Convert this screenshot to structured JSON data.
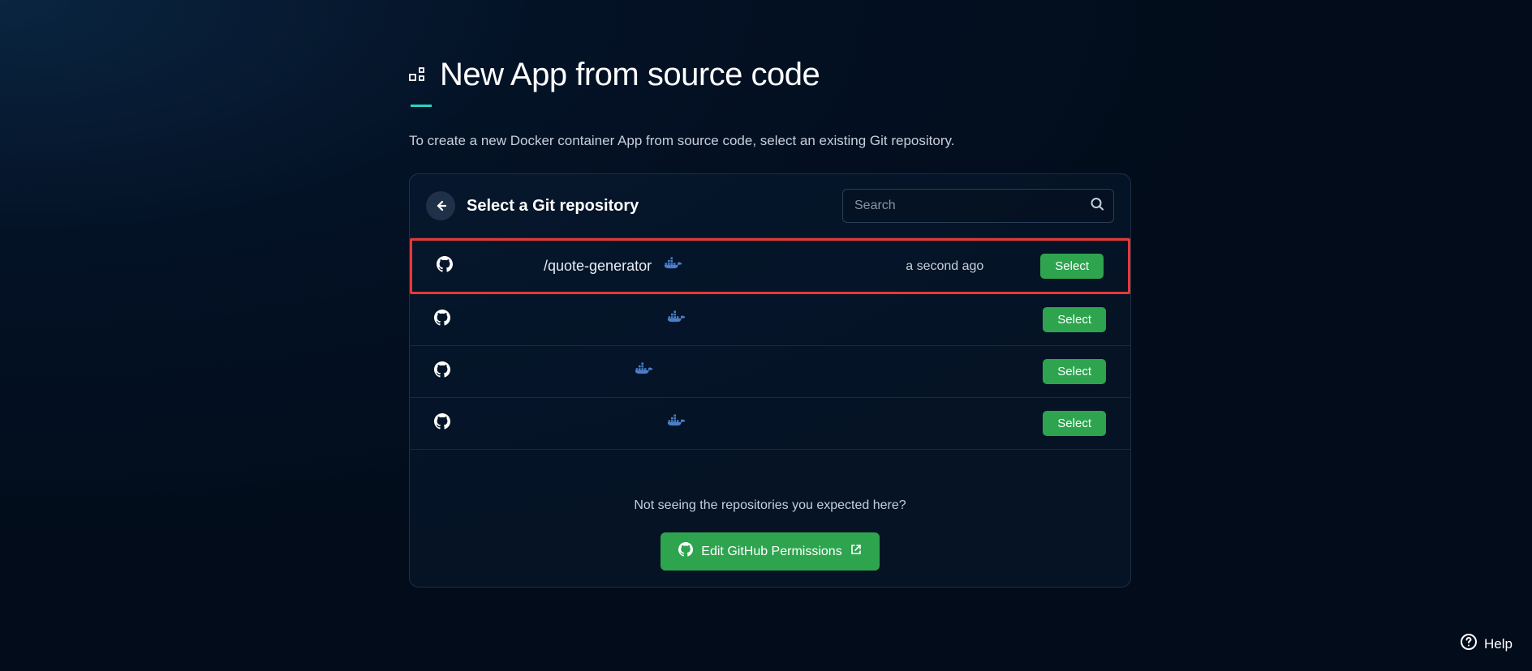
{
  "page": {
    "title": "New App from source code",
    "subtitle": "To create a new Docker container App from source code, select an existing Git repository."
  },
  "panel": {
    "title": "Select a Git repository",
    "search_placeholder": "Search"
  },
  "repos": [
    {
      "name": "/quote-generator",
      "timestamp": "a second ago",
      "highlighted": true,
      "name_indent": 90
    },
    {
      "name": "",
      "timestamp": "",
      "highlighted": false,
      "name_indent": 210
    },
    {
      "name": "",
      "timestamp": "",
      "highlighted": false,
      "name_indent": 170
    },
    {
      "name": "",
      "timestamp": "",
      "highlighted": false,
      "name_indent": 210
    }
  ],
  "buttons": {
    "select": "Select",
    "edit_permissions": "Edit GitHub Permissions",
    "help": "Help"
  },
  "footer": {
    "prompt": "Not seeing the repositories you expected here?"
  }
}
